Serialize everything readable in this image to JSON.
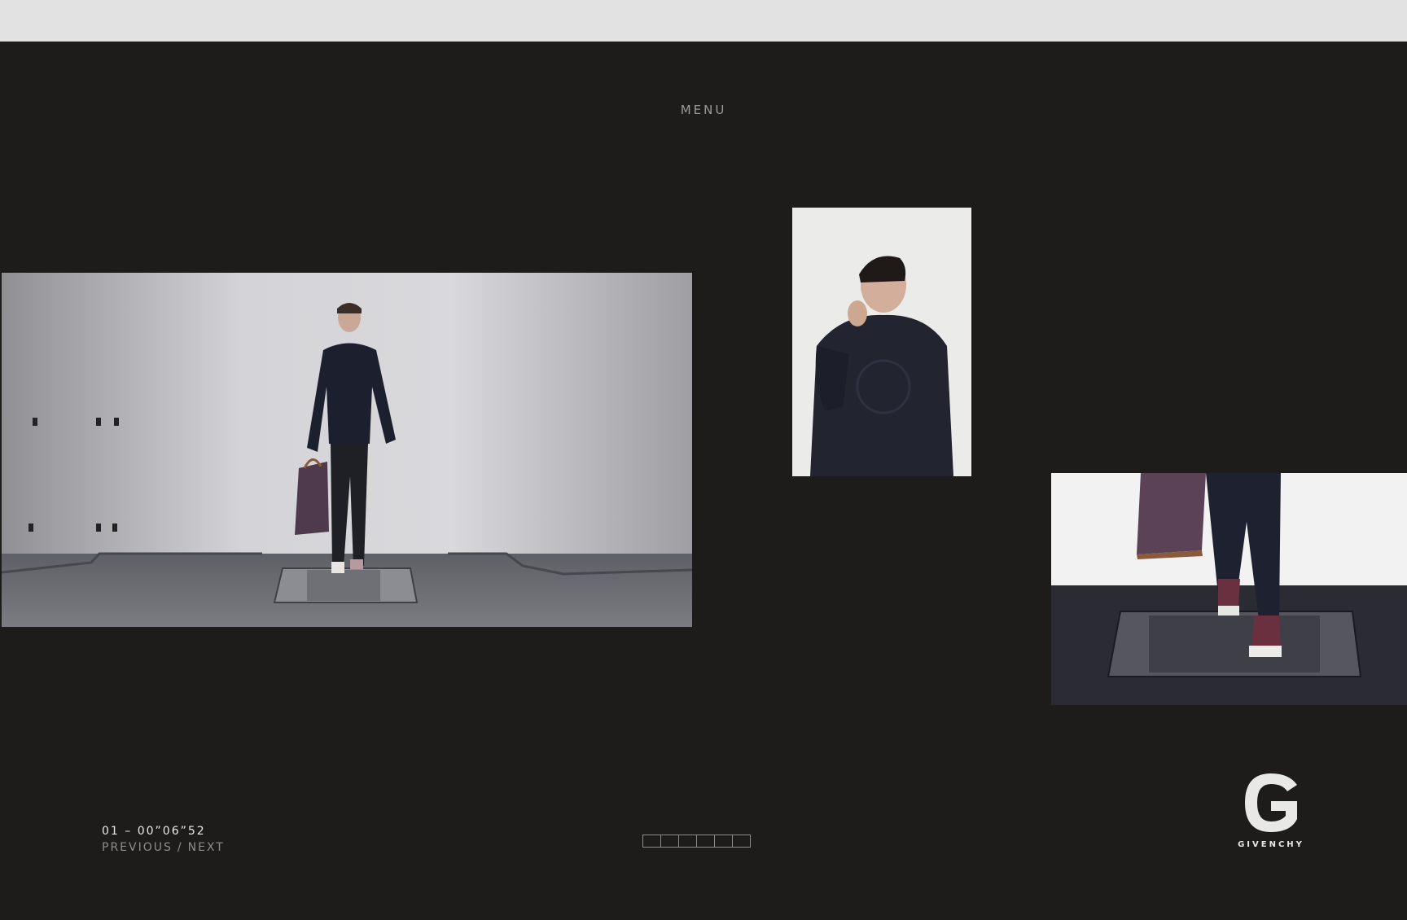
{
  "nav": {
    "menu_label": "MENU"
  },
  "player": {
    "counter": "01 – 00”06”52",
    "previous_label": "PREVIOUS",
    "separator": "/",
    "next_label": "NEXT",
    "progress_segments": 6
  },
  "brand": {
    "wordmark": "GIVENCHY",
    "monogram": "G"
  },
  "colors": {
    "background": "#1d1c1b",
    "browser_chrome": "#e2e2e2",
    "text_light": "#e8e8e6",
    "text_muted": "#8d8d8b"
  }
}
